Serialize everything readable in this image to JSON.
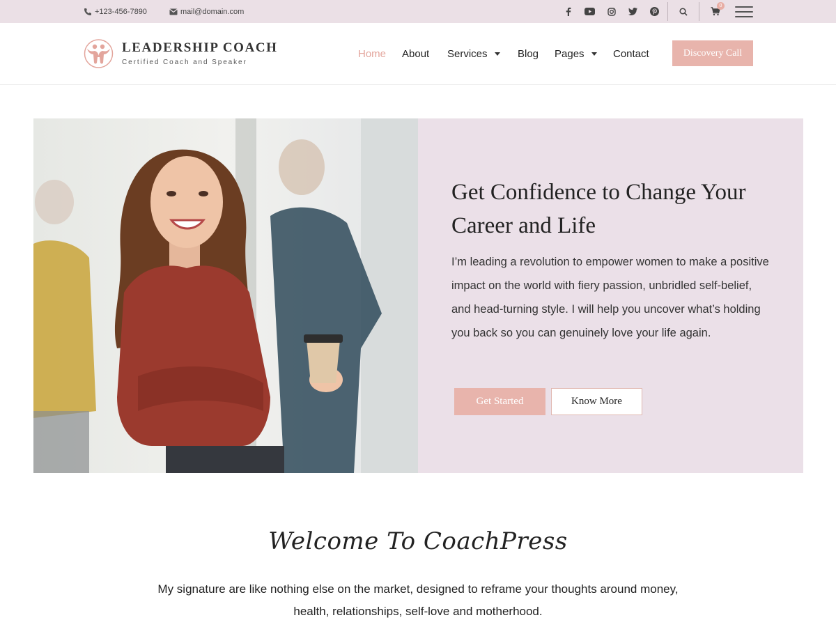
{
  "topbar": {
    "phone": "+123-456-7890",
    "email": "mail@domain.com",
    "socials": [
      "facebook-icon",
      "youtube-icon",
      "instagram-icon",
      "twitter-icon",
      "pinterest-icon"
    ],
    "cart_count": "0"
  },
  "header": {
    "title": "LEADERSHIP COACH",
    "tagline": "Certified Coach and Speaker",
    "nav": {
      "home": "Home",
      "about": "About",
      "services": "Services",
      "blog": "Blog",
      "pages": "Pages",
      "contact": "Contact"
    },
    "cta_label": "Discovery Call"
  },
  "hero": {
    "title": "Get Confidence to Change Your Career and Life",
    "text": "I’m leading a revolution to empower women to make a positive impact on the world with fiery passion, unbridled self-belief, and head-turning style. I will help you uncover what’s holding you back so you can genuinely love your life again.",
    "primary_label": "Get Started",
    "secondary_label": "Know More"
  },
  "welcome": {
    "title": "Welcome To CoachPress",
    "text": "My signature are like nothing else on the market, designed to reframe your thoughts around money, health, relationships, self-love and motherhood."
  },
  "colors": {
    "accent": "#e8b4ac",
    "topbar_bg": "#ebe0e6",
    "panel_bg": "#ebe0e8",
    "nav_active": "#e3a59c"
  }
}
